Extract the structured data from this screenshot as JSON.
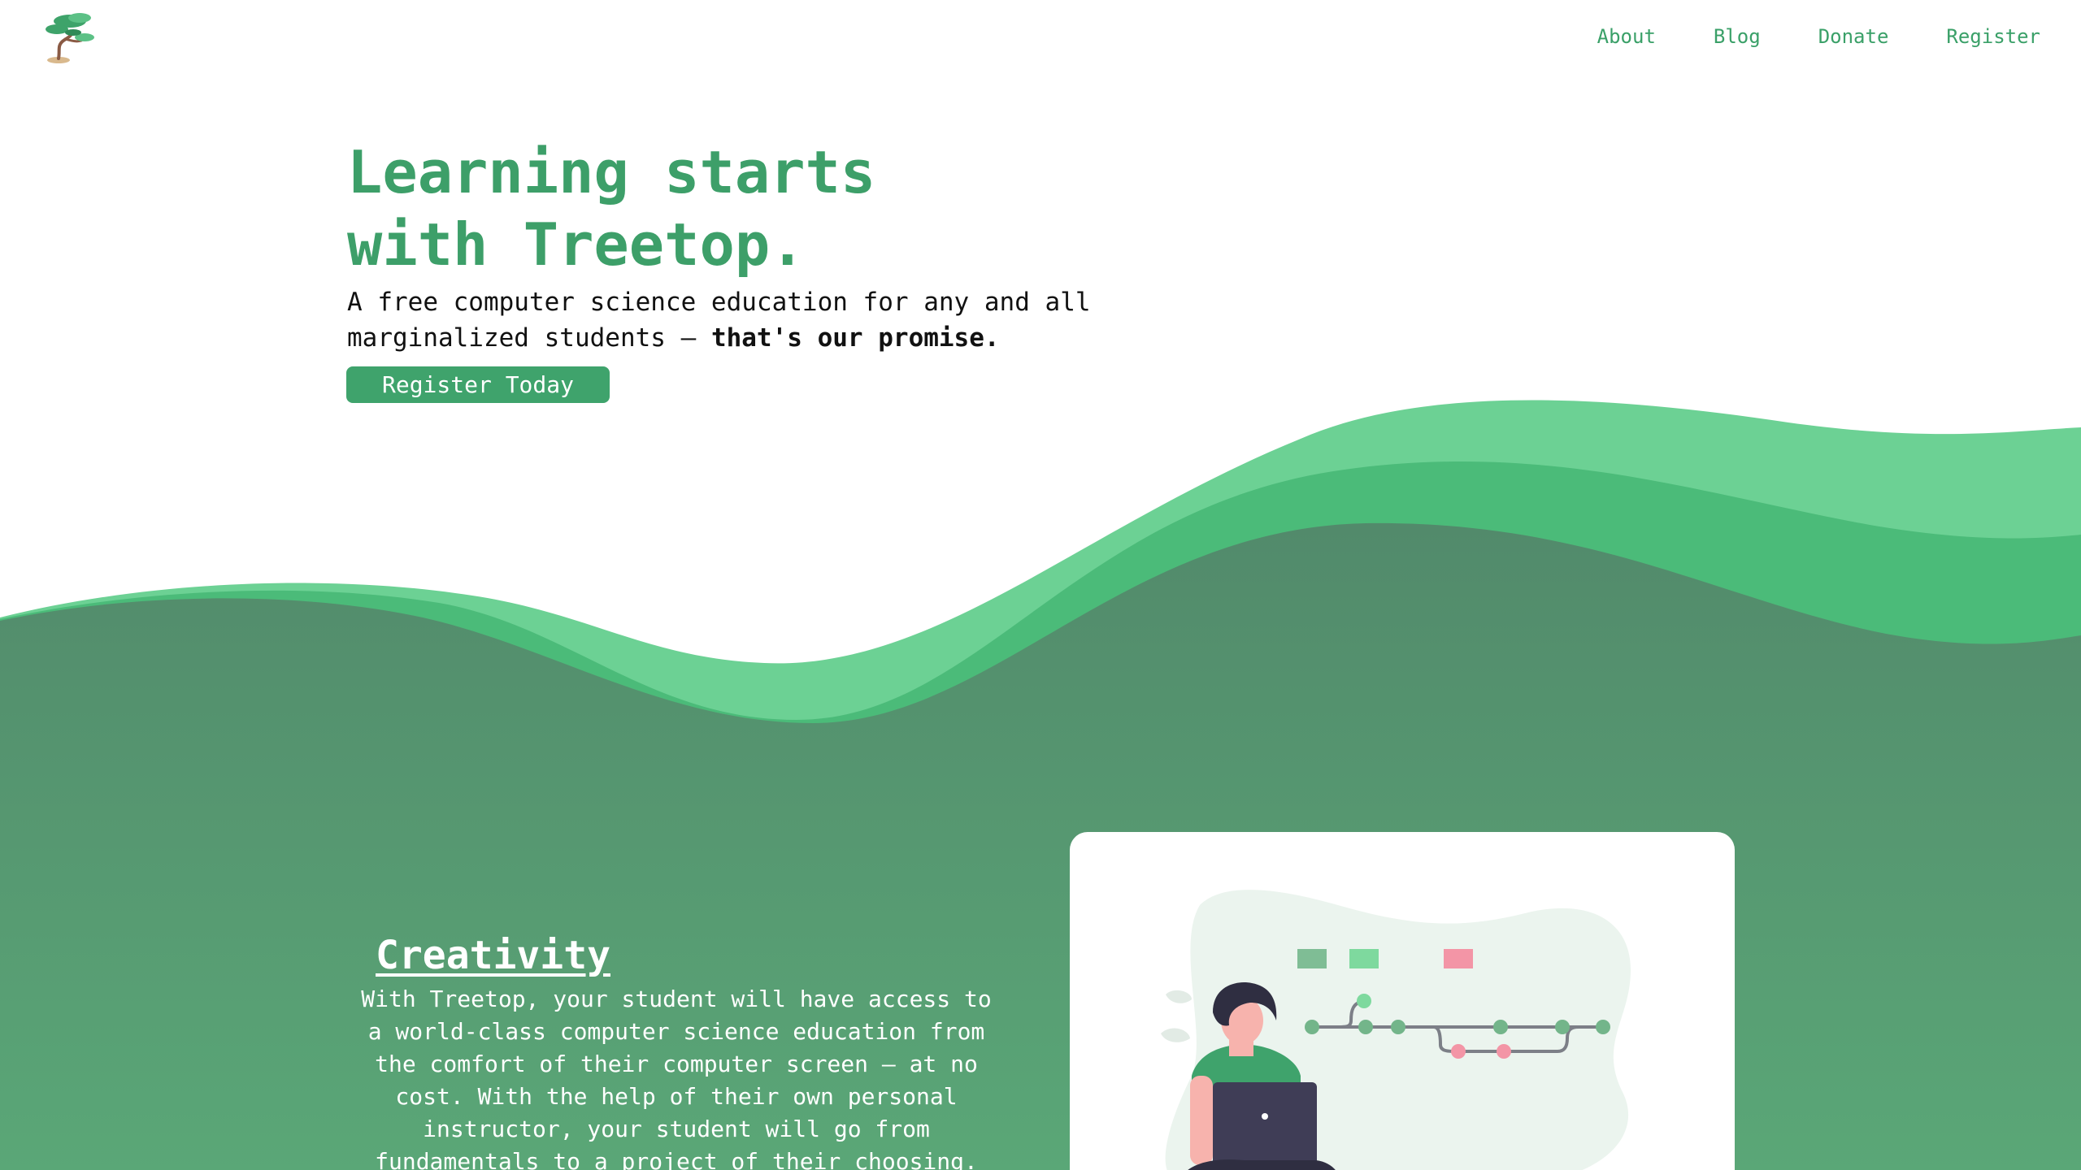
{
  "brand": {
    "logo_icon": "bonsai-tree-icon"
  },
  "nav": {
    "items": [
      {
        "label": "About"
      },
      {
        "label": "Blog"
      },
      {
        "label": "Donate"
      },
      {
        "label": "Register"
      }
    ]
  },
  "hero": {
    "title": "Learning starts\nwith Treetop.",
    "subtitle_plain": "A free computer science education for any and all marginalized students — ",
    "subtitle_bold": "that's our promise.",
    "cta_label": "Register Today"
  },
  "feature": {
    "title": "Creativity",
    "body": "With Treetop, your student will have access to a world-class computer science education from the comfort of their computer screen — at no cost. With the help of their own personal instructor, your student will go from fundamentals to a project of their choosing.",
    "illustration_icon": "student-laptop-illustration"
  },
  "colors": {
    "brand_green": "#3d9f69",
    "wave_light": "#6cd194",
    "wave_mid": "#4bbb79",
    "section_bg": "#568d6d"
  }
}
